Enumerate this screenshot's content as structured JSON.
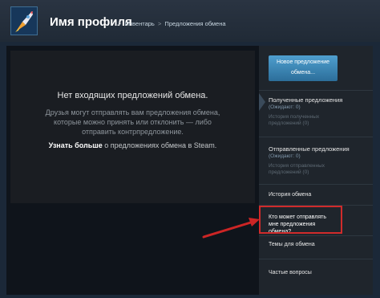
{
  "header": {
    "profile_name": "Имя профиля",
    "breadcrumb": [
      {
        "label": "Инвентарь"
      },
      {
        "label": "Предложения обмена"
      }
    ],
    "separator": ">"
  },
  "main": {
    "empty_title": "Нет входящих предложений обмена.",
    "empty_desc": "Друзья могут отправлять вам предложения обмена, которые можно принять или отклонить — либо отправить контрпредложение.",
    "learn_more_bold": "Узнать больше",
    "learn_more_rest": " о предложениях обмена в Steam."
  },
  "sidebar": {
    "new_offer_button": "Новое предложение обмена...",
    "received": {
      "label": "Полученные предложения",
      "sub": "(Ожидают: 0)",
      "history": "История полученных предложений (0)"
    },
    "sent": {
      "label": "Отправленные предложения",
      "sub": "(Ожидают: 0)",
      "history": "История отправленных предложений (0)"
    },
    "trade_history": "История обмена",
    "who_can_send": "Кто может отправлять мне предложения обмена?",
    "trade_topics": "Темы для обмена",
    "faq": "Частые вопросы"
  },
  "colors": {
    "accent": "#67c1f5",
    "highlight": "#d02b2b",
    "button_top": "#4f9fcf",
    "button_bottom": "#2c6e9a"
  },
  "icons": {
    "avatar": "rocket-avatar-icon"
  }
}
